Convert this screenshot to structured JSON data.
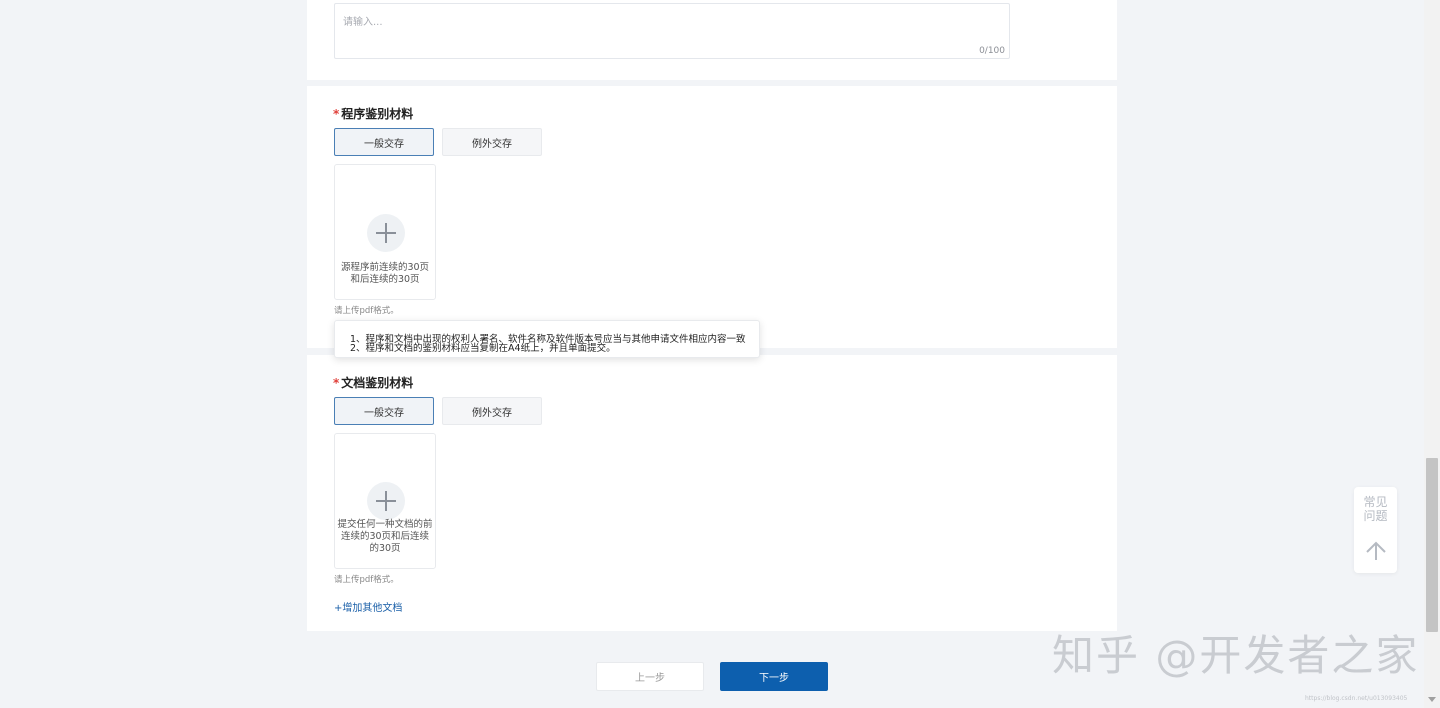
{
  "top": {
    "placeholder": "请输入...",
    "counter": "0/100"
  },
  "program": {
    "title": "程序鉴别材料",
    "tabs": [
      "一般交存",
      "例外交存"
    ],
    "upload_desc": "源程序前连续的30页和后连续的30页",
    "hint": "请上传pdf格式。"
  },
  "tooltip": {
    "lines": [
      "1、程序和文档中出现的权利人署名、软件名称及软件版本号应当与其他申请文件相应内容一致",
      "2、程序和文档的鉴别材料应当复制在A4纸上，并且单面提交。"
    ]
  },
  "document": {
    "title": "文档鉴别材料",
    "tabs": [
      "一般交存",
      "例外交存"
    ],
    "upload_desc": "提交任何一种文档的前连续的30页和后连续的30页",
    "hint": "请上传pdf格式。",
    "add_link": "+增加其他文档"
  },
  "nav": {
    "prev": "上一步",
    "next": "下一步"
  },
  "float": {
    "faq": "常见问题"
  },
  "watermark": {
    "text": "知乎 @开发者之家",
    "url": "https://blog.csdn.net/u013093405"
  },
  "colors": {
    "primary": "#0d5fae",
    "required": "#e0403a",
    "link": "#1a5fa8"
  }
}
